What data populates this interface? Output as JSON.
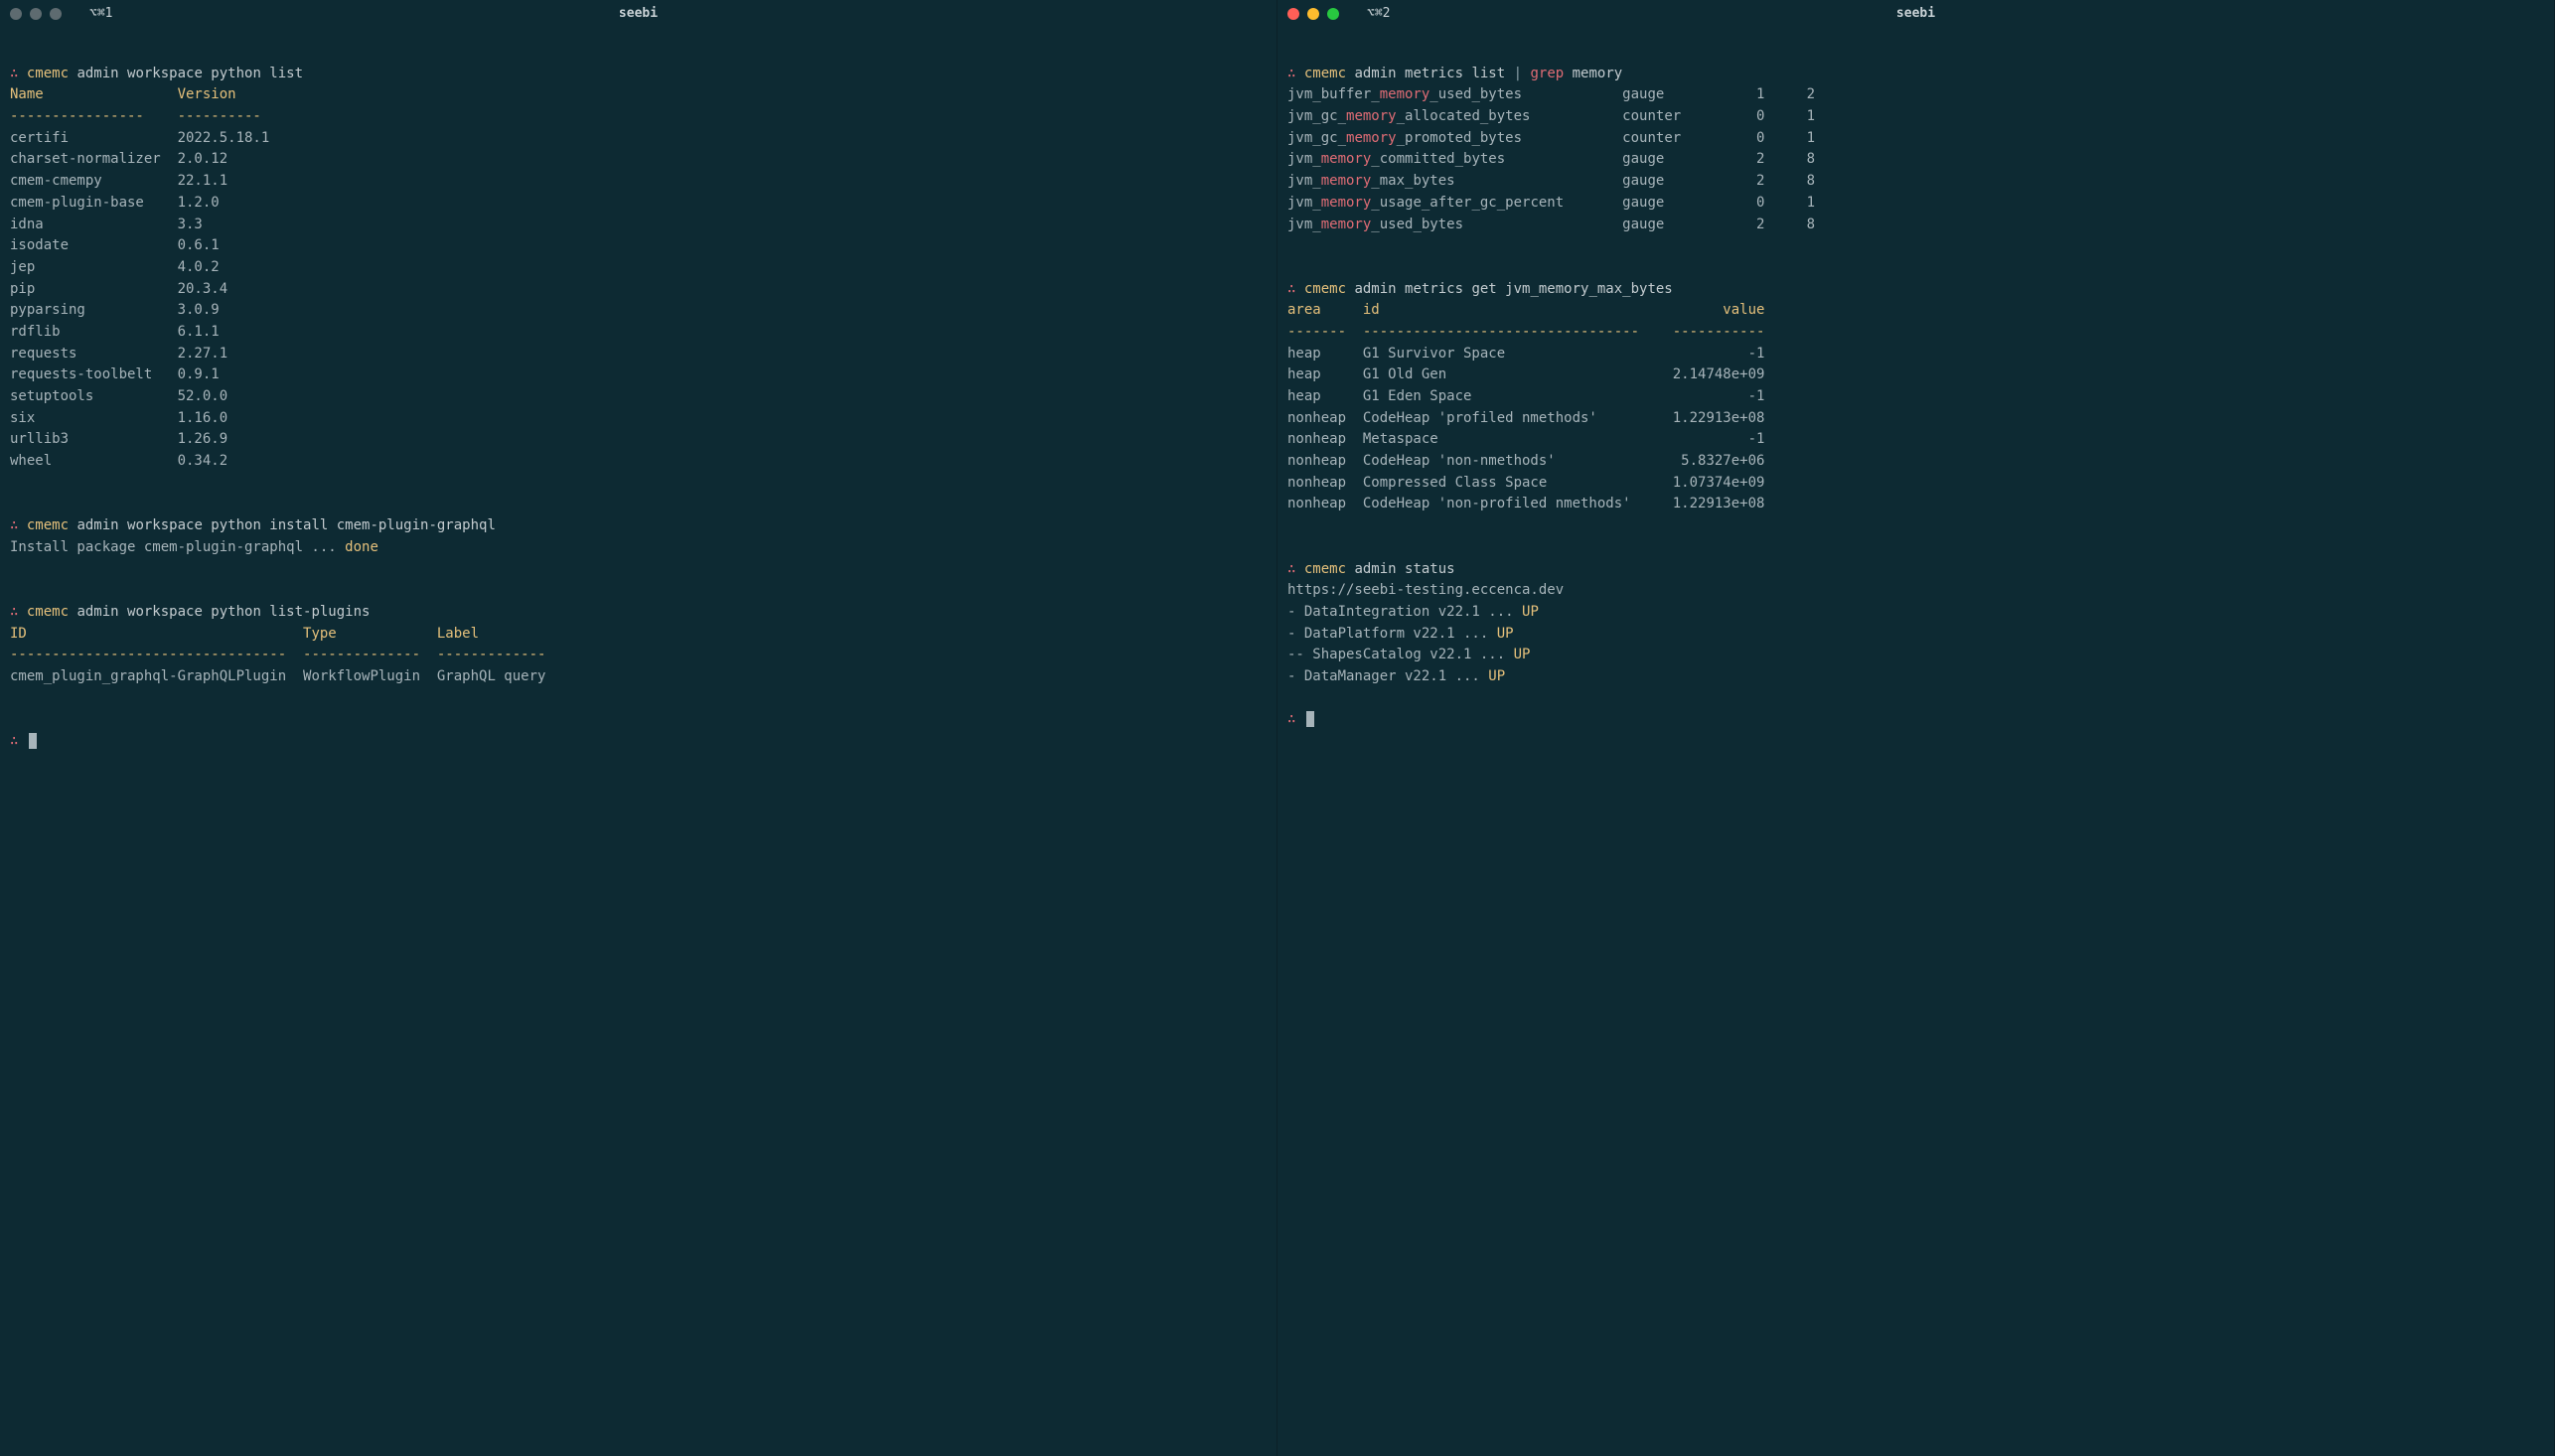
{
  "left": {
    "tab": "⌥⌘1",
    "title": "seebi",
    "prompt": "∴",
    "exe": "cmemc",
    "cmd1": "admin workspace python list",
    "packages_header": {
      "name": "Name",
      "version": "Version"
    },
    "packages_div": {
      "name": "----------------",
      "version": "----------"
    },
    "packages": [
      {
        "name": "certifi",
        "version": "2022.5.18.1"
      },
      {
        "name": "charset-normalizer",
        "version": "2.0.12"
      },
      {
        "name": "cmem-cmempy",
        "version": "22.1.1"
      },
      {
        "name": "cmem-plugin-base",
        "version": "1.2.0"
      },
      {
        "name": "idna",
        "version": "3.3"
      },
      {
        "name": "isodate",
        "version": "0.6.1"
      },
      {
        "name": "jep",
        "version": "4.0.2"
      },
      {
        "name": "pip",
        "version": "20.3.4"
      },
      {
        "name": "pyparsing",
        "version": "3.0.9"
      },
      {
        "name": "rdflib",
        "version": "6.1.1"
      },
      {
        "name": "requests",
        "version": "2.27.1"
      },
      {
        "name": "requests-toolbelt",
        "version": "0.9.1"
      },
      {
        "name": "setuptools",
        "version": "52.0.0"
      },
      {
        "name": "six",
        "version": "1.16.0"
      },
      {
        "name": "urllib3",
        "version": "1.26.9"
      },
      {
        "name": "wheel",
        "version": "0.34.2"
      }
    ],
    "cmd2": "admin workspace python install cmem-plugin-graphql",
    "install_pre": "Install package cmem-plugin-graphql ... ",
    "install_done": "done",
    "cmd3": "admin workspace python list-plugins",
    "plugins_header": {
      "id": "ID",
      "type": "Type",
      "label": "Label"
    },
    "plugins_div": {
      "id": "---------------------------------",
      "type": "--------------",
      "label": "-------------"
    },
    "plugins": [
      {
        "id": "cmem_plugin_graphql-GraphQLPlugin",
        "type": "WorkflowPlugin",
        "label": "GraphQL query"
      }
    ]
  },
  "right": {
    "tab": "⌥⌘2",
    "title": "seebi",
    "prompt": "∴",
    "exe": "cmemc",
    "cmd1_pre": "admin metrics list ",
    "cmd1_pipe": "|",
    "cmd1_grepcmd": " grep ",
    "cmd1_greparg": "memory",
    "metrics": [
      {
        "pre": "jvm_buffer_",
        "hi": "memory",
        "post": "_used_bytes",
        "type": "gauge",
        "a": "1",
        "b": "2"
      },
      {
        "pre": "jvm_gc_",
        "hi": "memory",
        "post": "_allocated_bytes",
        "type": "counter",
        "a": "0",
        "b": "1"
      },
      {
        "pre": "jvm_gc_",
        "hi": "memory",
        "post": "_promoted_bytes",
        "type": "counter",
        "a": "0",
        "b": "1"
      },
      {
        "pre": "jvm_",
        "hi": "memory",
        "post": "_committed_bytes",
        "type": "gauge",
        "a": "2",
        "b": "8"
      },
      {
        "pre": "jvm_",
        "hi": "memory",
        "post": "_max_bytes",
        "type": "gauge",
        "a": "2",
        "b": "8"
      },
      {
        "pre": "jvm_",
        "hi": "memory",
        "post": "_usage_after_gc_percent",
        "type": "gauge",
        "a": "0",
        "b": "1"
      },
      {
        "pre": "jvm_",
        "hi": "memory",
        "post": "_used_bytes",
        "type": "gauge",
        "a": "2",
        "b": "8"
      }
    ],
    "cmd2": "admin metrics get jvm_memory_max_bytes",
    "mem_header": {
      "area": "area",
      "id": "id",
      "value": "value"
    },
    "mem_div": {
      "area": "-------",
      "id": "---------------------------------",
      "value": "-----------"
    },
    "mem": [
      {
        "area": "heap",
        "id": "G1 Survivor Space",
        "value": "-1"
      },
      {
        "area": "heap",
        "id": "G1 Old Gen",
        "value": " 2.14748e+09"
      },
      {
        "area": "heap",
        "id": "G1 Eden Space",
        "value": "-1"
      },
      {
        "area": "nonheap",
        "id": "CodeHeap 'profiled nmethods'",
        "value": " 1.22913e+08"
      },
      {
        "area": "nonheap",
        "id": "Metaspace",
        "value": "-1"
      },
      {
        "area": "nonheap",
        "id": "CodeHeap 'non-nmethods'",
        "value": " 5.8327e+06"
      },
      {
        "area": "nonheap",
        "id": "Compressed Class Space",
        "value": " 1.07374e+09"
      },
      {
        "area": "nonheap",
        "id": "CodeHeap 'non-profiled nmethods'",
        "value": " 1.22913e+08"
      }
    ],
    "cmd3": "admin status",
    "status_url": "https://seebi-testing.eccenca.dev",
    "status_lines": [
      {
        "pre": "- DataIntegration v22.1 ... ",
        "up": "UP"
      },
      {
        "pre": "- DataPlatform v22.1 ... ",
        "up": "UP"
      },
      {
        "pre": "-- ShapesCatalog v22.1 ... ",
        "up": "UP"
      },
      {
        "pre": "- DataManager v22.1 ... ",
        "up": "UP"
      }
    ]
  }
}
